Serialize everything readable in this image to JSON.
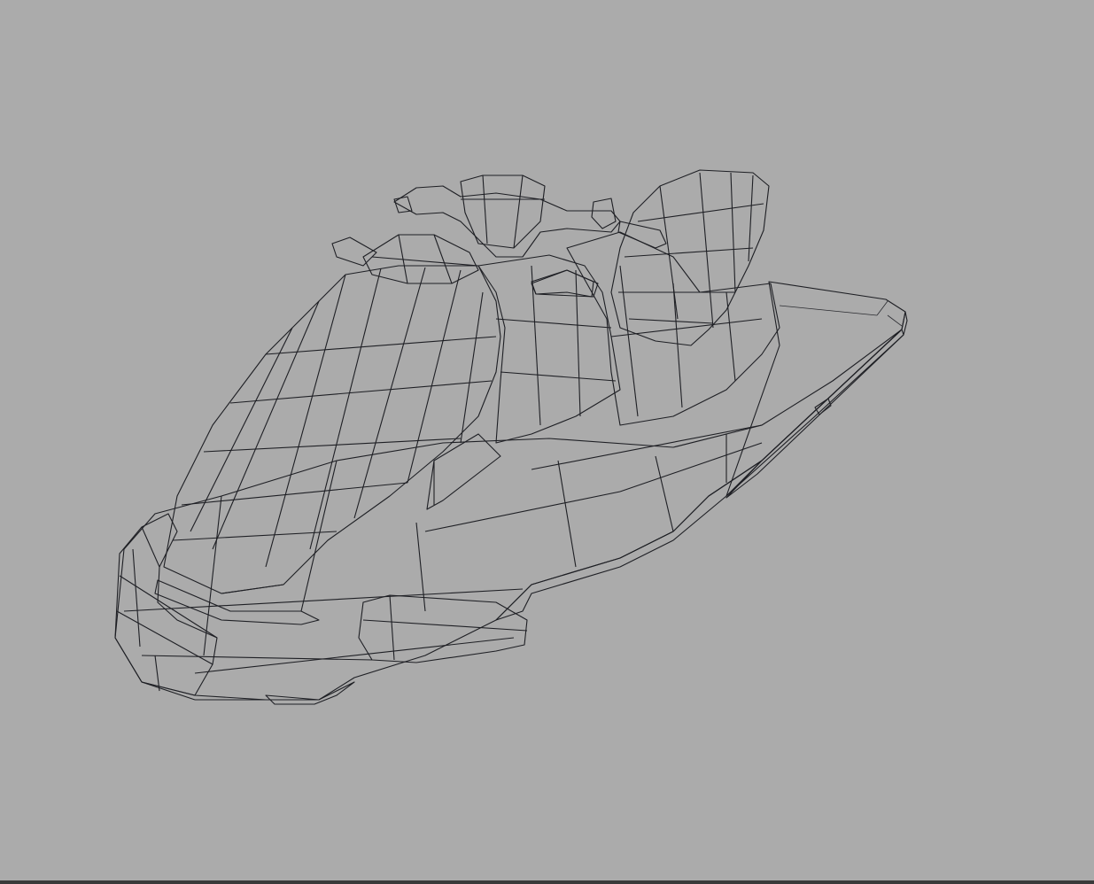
{
  "viewport": {
    "background": "#ababab",
    "model": {
      "shading": "wireframe-on-shaded",
      "surface_color": "#c4c6cd",
      "highlight_color": "#eceef2",
      "shadow_color": "#8e9099",
      "wire_color": "#1e1f24"
    }
  }
}
